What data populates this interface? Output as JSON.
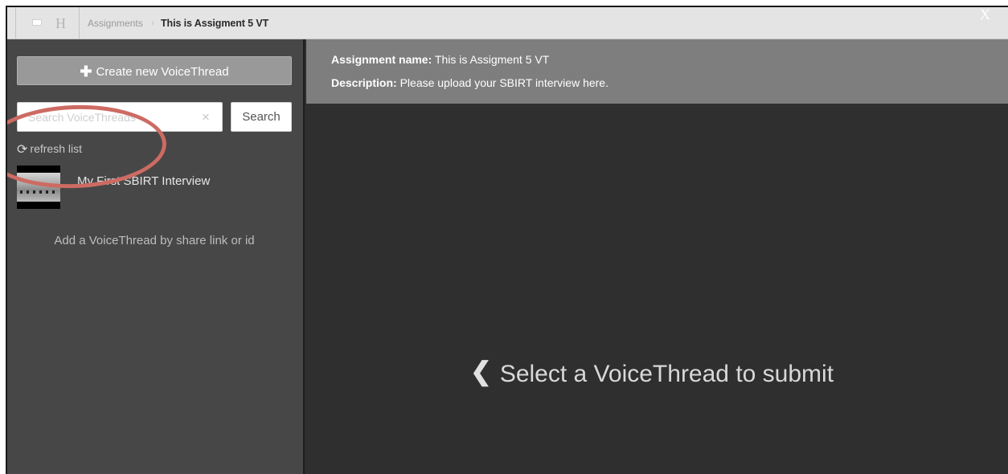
{
  "header": {
    "menu_icon": "window-icon",
    "home_glyph": "H",
    "breadcrumb_parent": "Assignments",
    "breadcrumb_separator": "›",
    "breadcrumb_current": "This is Assigment 5 VT",
    "close_glyph": "X"
  },
  "sidebar": {
    "create_label": "Create new VoiceThread",
    "create_icon": "plus-icon",
    "search_placeholder": "Search VoiceThreads",
    "search_clear": "×",
    "search_button": "Search",
    "refresh_icon": "refresh-icon",
    "refresh_label": "refresh list",
    "items": [
      {
        "title": "My First SBIRT Interview"
      }
    ],
    "add_link": "Add a VoiceThread by share link or id"
  },
  "assignment": {
    "name_label": "Assignment name:",
    "name_value": "This is Assigment 5 VT",
    "description_label": "Description:",
    "description_value": "Please upload your SBIRT interview here."
  },
  "main": {
    "prompt_icon": "chevron-left-icon",
    "prompt_text": "Select a VoiceThread to submit"
  },
  "annotation": {
    "color": "#cd6b63"
  }
}
